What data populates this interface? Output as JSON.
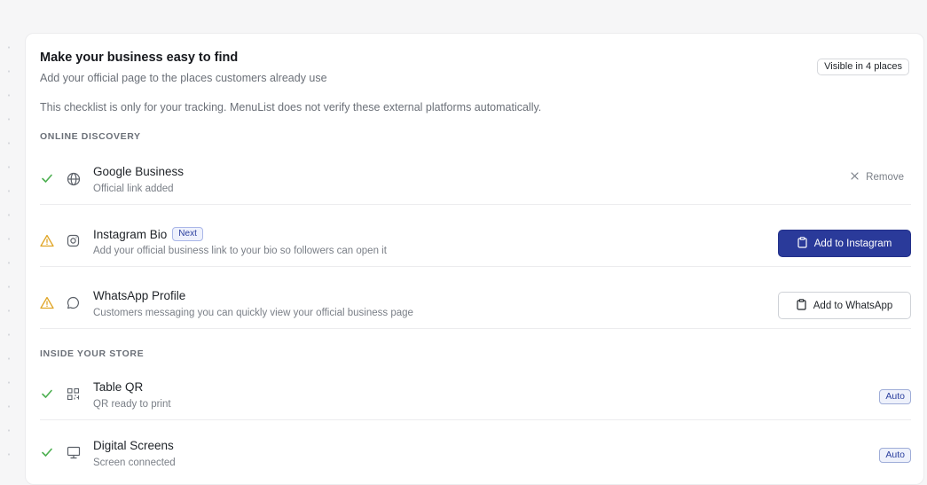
{
  "card": {
    "title": "Make your business easy to find",
    "subtitle": "Add your official page to the places customers already use",
    "note": "This checklist is only for your tracking. MenuList does not verify these external platforms automatically.",
    "visible_badge": "Visible in 4 places"
  },
  "sections": {
    "online": {
      "title": "ONLINE DISCOVERY"
    },
    "store": {
      "title": "INSIDE YOUR STORE"
    }
  },
  "rows": {
    "google": {
      "name": "Google Business",
      "desc": "Official link added",
      "status": "done",
      "icon": "globe-icon",
      "action": "Remove"
    },
    "instagram": {
      "name": "Instagram Bio",
      "badge": "Next",
      "desc": "Add your official business link to your bio so followers can open it",
      "status": "warning",
      "icon": "instagram-icon",
      "action": "Add to Instagram"
    },
    "whatsapp": {
      "name": "WhatsApp Profile",
      "desc": "Customers messaging you can quickly view your official business page",
      "status": "warning",
      "icon": "chat-bubble-icon",
      "action": "Add to WhatsApp"
    },
    "table_qr": {
      "name": "Table QR",
      "desc": "QR ready to print",
      "status": "done",
      "icon": "qr-code-icon",
      "badge": "Auto"
    },
    "screens": {
      "name": "Digital Screens",
      "desc": "Screen connected",
      "status": "done",
      "icon": "monitor-icon",
      "badge": "Auto"
    }
  },
  "colors": {
    "success": "#4caf50",
    "warning": "#e0a526",
    "primary": "#2a3a9a",
    "badge_blue": "#2b3f9e"
  }
}
